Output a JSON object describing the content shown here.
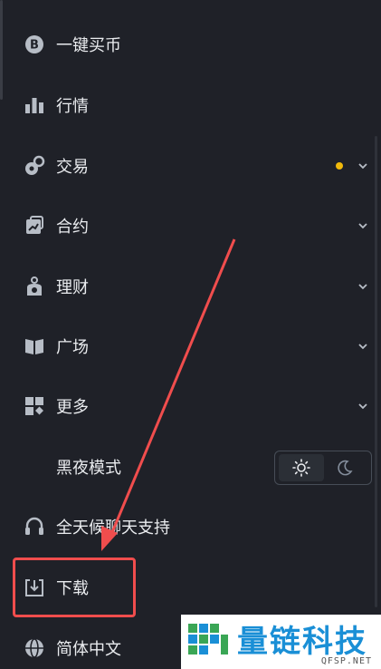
{
  "menu": {
    "items": [
      {
        "label": "一键买币",
        "icon": "bitcoin-icon"
      },
      {
        "label": "行情",
        "icon": "bar-chart-icon"
      },
      {
        "label": "交易",
        "icon": "trade-icon",
        "badge_dot": true,
        "expandable": true
      },
      {
        "label": "合约",
        "icon": "contract-icon",
        "expandable": true
      },
      {
        "label": "理财",
        "icon": "finance-icon",
        "expandable": true
      },
      {
        "label": "广场",
        "icon": "book-icon",
        "expandable": true
      },
      {
        "label": "更多",
        "icon": "more-grid-icon",
        "expandable": true
      },
      {
        "label": "黑夜模式"
      },
      {
        "label": "全天候聊天支持",
        "icon": "headset-icon"
      },
      {
        "label": "下载",
        "icon": "download-icon"
      },
      {
        "label": "简体中文",
        "icon": "globe-icon"
      }
    ]
  },
  "theme_toggle": {
    "options": [
      "light",
      "dark"
    ],
    "selected": "light"
  },
  "watermark": {
    "title": "量链科技",
    "subtitle": "QFSP.NET"
  },
  "colors": {
    "background": "#1f2128",
    "text": "#eaecef",
    "icon": "#b7bdc6",
    "badge_dot": "#f0b90b",
    "annotation": "#f04d4d",
    "watermark_brand": "#1a8fd6"
  }
}
